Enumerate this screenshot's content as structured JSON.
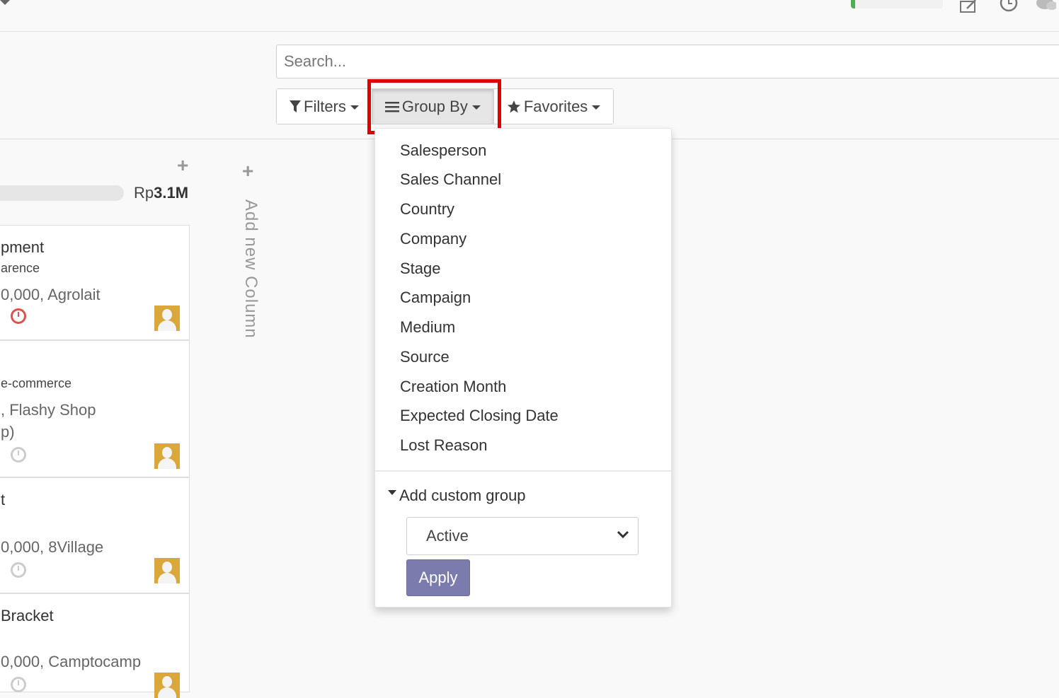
{
  "search": {
    "placeholder": "Search..."
  },
  "toolbar": {
    "filters_label": "Filters",
    "group_by_label": "Group By",
    "favorites_label": "Favorites"
  },
  "column": {
    "currency_prefix": "Rp",
    "total": "3.1M",
    "cards": [
      {
        "title": "pment",
        "tag": "arence",
        "detail": "0,000, Agrolait",
        "detail2": "",
        "activity": "overdue"
      },
      {
        "title": "",
        "tag": "e-commerce",
        "detail": ", Flashy Shop",
        "detail2": "p)",
        "activity": "none"
      },
      {
        "title": "t",
        "tag": "",
        "detail": "0,000, 8Village",
        "detail2": "",
        "activity": "none"
      },
      {
        "title": "Bracket",
        "tag": "",
        "detail": "0,000, Camptocamp",
        "detail2": "",
        "activity": "none"
      }
    ]
  },
  "new_column": {
    "label": "Add new Column"
  },
  "group_by_menu": {
    "items": [
      "Salesperson",
      "Sales Channel",
      "Country",
      "Company",
      "Stage",
      "Campaign",
      "Medium",
      "Source",
      "Creation Month",
      "Expected Closing Date",
      "Lost Reason"
    ],
    "custom_group_label": "Add custom group",
    "custom_group_selected": "Active",
    "apply_label": "Apply"
  },
  "colors": {
    "highlight": "#e00000",
    "apply_button": "#7c7bad",
    "overdue_clock": "#d9534f",
    "avatar_bg": "#d9a73a"
  }
}
